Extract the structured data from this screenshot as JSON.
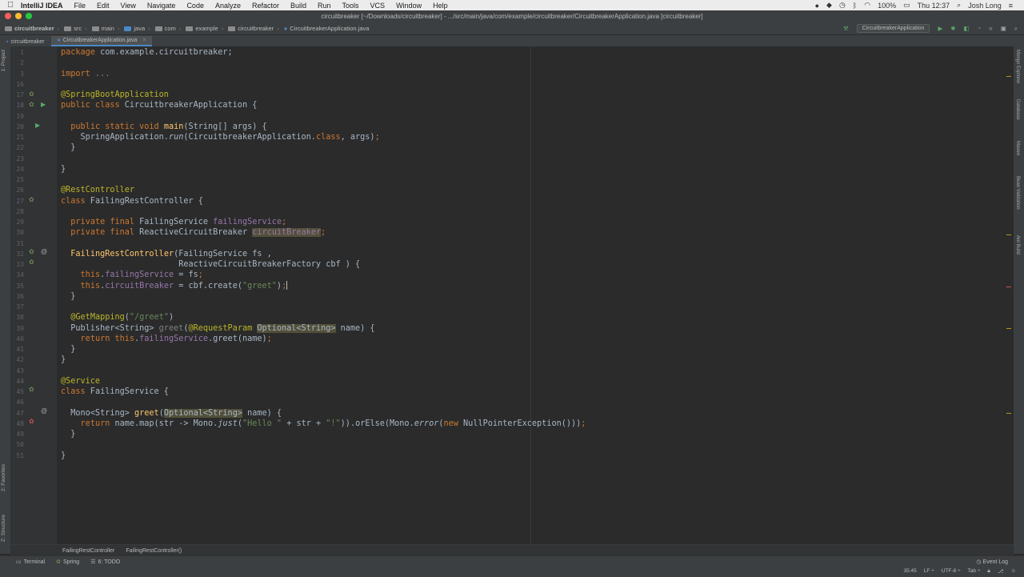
{
  "menubar": {
    "app_name": "IntelliJ IDEA",
    "menus": [
      "File",
      "Edit",
      "View",
      "Navigate",
      "Code",
      "Analyze",
      "Refactor",
      "Build",
      "Run",
      "Tools",
      "VCS",
      "Window",
      "Help"
    ],
    "battery": "100%",
    "time": "Thu 12:37",
    "user": "Josh Long"
  },
  "window": {
    "title": "circuitbreaker [~/Downloads/circuitbreaker] - .../src/main/java/com/example/circuitbreaker/CircuitbreakerApplication.java [circuitbreaker]"
  },
  "navbar": {
    "crumbs": [
      "circuitbreaker",
      "src",
      "main",
      "java",
      "com",
      "example",
      "circuitbreaker",
      "CircuitbreakerApplication.java"
    ],
    "run_config": "CircuitbreakerApplication"
  },
  "tabs": {
    "project": "circuitbreaker",
    "file": "CircuitbreakerApplication.java"
  },
  "left_stripe": {
    "project": "1: Project",
    "favorites": "2: Favorites",
    "structure": "Z: Structure"
  },
  "right_stripe": [
    "Mongo Explorer",
    "Database",
    "Maven",
    "Bean Validation",
    "Ant Build"
  ],
  "code": [
    {
      "n": "1",
      "html": "<span class=\"kw\">package</span> com.example.circuitbreaker;"
    },
    {
      "n": "2",
      "html": ""
    },
    {
      "n": "3",
      "html": "<span class=\"kw\">import</span> <span class=\"dim\">...</span>"
    },
    {
      "n": "16",
      "html": ""
    },
    {
      "n": "17",
      "html": "<span class=\"ann\">@SpringBootApplication</span>"
    },
    {
      "n": "18",
      "html": "<span class=\"kw\">public class</span> CircuitbreakerApplication {"
    },
    {
      "n": "19",
      "html": ""
    },
    {
      "n": "20",
      "html": "  <span class=\"kw\">public static void</span> <span class=\"fn\">main</span>(String[] args) {"
    },
    {
      "n": "21",
      "html": "    SpringApplication.<span class=\"it\">run</span>(CircuitbreakerApplication.<span class=\"kw\">class</span>, args)<span class=\"kw\">;</span>"
    },
    {
      "n": "22",
      "html": "  }"
    },
    {
      "n": "23",
      "html": ""
    },
    {
      "n": "24",
      "html": "}"
    },
    {
      "n": "25",
      "html": ""
    },
    {
      "n": "26",
      "html": "<span class=\"ann\">@RestController</span>"
    },
    {
      "n": "27",
      "html": "<span class=\"kw\">class</span> FailingRestController {"
    },
    {
      "n": "28",
      "html": ""
    },
    {
      "n": "29",
      "html": "  <span class=\"kw\">private final</span> FailingService <span class=\"fld\">failingService</span><span class=\"kw\">;</span>"
    },
    {
      "n": "30",
      "html": "  <span class=\"kw\">private final</span> ReactiveCircuitBreaker <span class=\"fld warn\">circuitBreaker</span><span class=\"kw\">;</span>"
    },
    {
      "n": "31",
      "html": ""
    },
    {
      "n": "32",
      "html": "  <span class=\"fn\">FailingRestController</span>(FailingService fs ,"
    },
    {
      "n": "33",
      "html": "                        ReactiveCircuitBreakerFactory cbf ) {"
    },
    {
      "n": "34",
      "html": "    <span class=\"kw\">this</span>.<span class=\"fld\">failingService</span> = fs<span class=\"kw\">;</span>"
    },
    {
      "n": "35",
      "html": "    <span class=\"kw\">this</span>.<span class=\"fld\">circuitBreaker</span> = cbf.create(<span class=\"str\">\"greet\"</span>)<span class=\"kw\">;</span><span class=\"caret\"></span>"
    },
    {
      "n": "36",
      "html": "  }"
    },
    {
      "n": "37",
      "html": ""
    },
    {
      "n": "38",
      "html": "  <span class=\"ann\">@GetMapping</span>(<span class=\"str\">\"/greet\"</span>)"
    },
    {
      "n": "39",
      "html": "  Publisher&lt;String&gt; <span class=\"dim\">greet</span>(<span class=\"ann\">@RequestParam</span> <span class=\"warn\">Optional&lt;String&gt;</span> name) {"
    },
    {
      "n": "40",
      "html": "    <span class=\"kw\">return this</span>.<span class=\"fld\">failingService</span>.greet(name)<span class=\"kw\">;</span>"
    },
    {
      "n": "41",
      "html": "  }"
    },
    {
      "n": "42",
      "html": "}"
    },
    {
      "n": "43",
      "html": ""
    },
    {
      "n": "44",
      "html": "<span class=\"ann\">@Service</span>"
    },
    {
      "n": "45",
      "html": "<span class=\"kw\">class</span> FailingService {"
    },
    {
      "n": "46",
      "html": ""
    },
    {
      "n": "47",
      "html": "  Mono&lt;String&gt; <span class=\"fn\">greet</span>(<span class=\"warn\">Optional&lt;String&gt;</span> name) {"
    },
    {
      "n": "48",
      "html": "    <span class=\"kw\">return</span> name.map(str -&gt; Mono.<span class=\"it\">just</span>(<span class=\"str\">\"Hello \"</span> + str + <span class=\"str\">\"!\"</span>)).orElse(Mono.<span class=\"it\">error</span>(<span class=\"kw\">new</span> NullPointerException()))<span class=\"kw\">;</span>"
    },
    {
      "n": "49",
      "html": "  }"
    },
    {
      "n": "50",
      "html": ""
    },
    {
      "n": "51",
      "html": "}"
    }
  ],
  "bottom_breadcrumb": [
    "FailingRestController",
    "FailingRestController()"
  ],
  "status": {
    "tools": [
      "Terminal",
      "Spring",
      "6: TODO"
    ],
    "event_log": "Event Log",
    "position": "35:45",
    "line_sep": "LF ÷",
    "encoding": "UTF-8 ÷",
    "indent": "Tab ÷"
  },
  "colors": {
    "editor_bg": "#2b2b2b",
    "keyword": "#cc7832",
    "annotation": "#bbb529",
    "string": "#6a8759",
    "field": "#9876aa"
  }
}
